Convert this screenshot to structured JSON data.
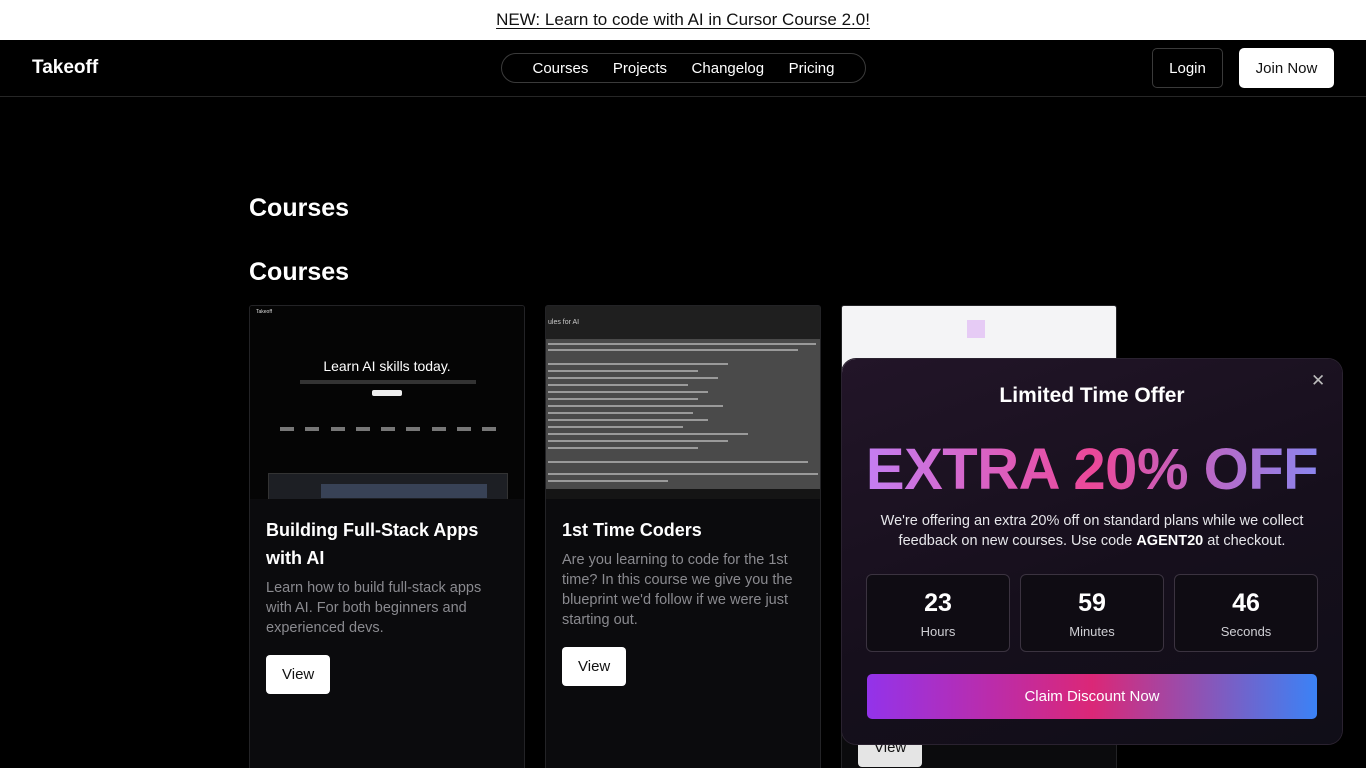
{
  "announcement": {
    "text": "NEW: Learn to code with AI in Cursor Course 2.0!"
  },
  "header": {
    "logo": "Takeoff",
    "nav": [
      "Courses",
      "Projects",
      "Changelog",
      "Pricing"
    ],
    "login": "Login",
    "join": "Join Now"
  },
  "main": {
    "page_title": "Courses",
    "section_title": "Courses",
    "cards": [
      {
        "title": "Building Full-Stack Apps with AI",
        "description": "Learn how to build full-stack apps with AI. For both beginners and experienced devs.",
        "button": "View",
        "thumbnail_heading": "Learn AI skills today."
      },
      {
        "title": "1st Time Coders",
        "description": "Are you learning to code for the 1st time? In this course we give you the blueprint we'd follow if we were just starting out.",
        "button": "View"
      },
      {
        "title": "",
        "description": "",
        "button": "View"
      }
    ]
  },
  "modal": {
    "title": "Limited Time Offer",
    "headline": "EXTRA 20% OFF",
    "text_before": "We're offering an extra 20% off on standard plans while we collect feedback on new courses. Use code ",
    "code": "AGENT20",
    "text_after": " at checkout.",
    "countdown": [
      {
        "value": "23",
        "label": "Hours"
      },
      {
        "value": "59",
        "label": "Minutes"
      },
      {
        "value": "46",
        "label": "Seconds"
      }
    ],
    "cta": "Claim Discount Now",
    "close_glyph": "✕"
  },
  "colors": {
    "background": "#000000",
    "headline_gradient": [
      "#c084fc",
      "#ec4899",
      "#818cf8"
    ],
    "cta_gradient": [
      "#9333ea",
      "#db2777",
      "#3b82f6"
    ]
  }
}
